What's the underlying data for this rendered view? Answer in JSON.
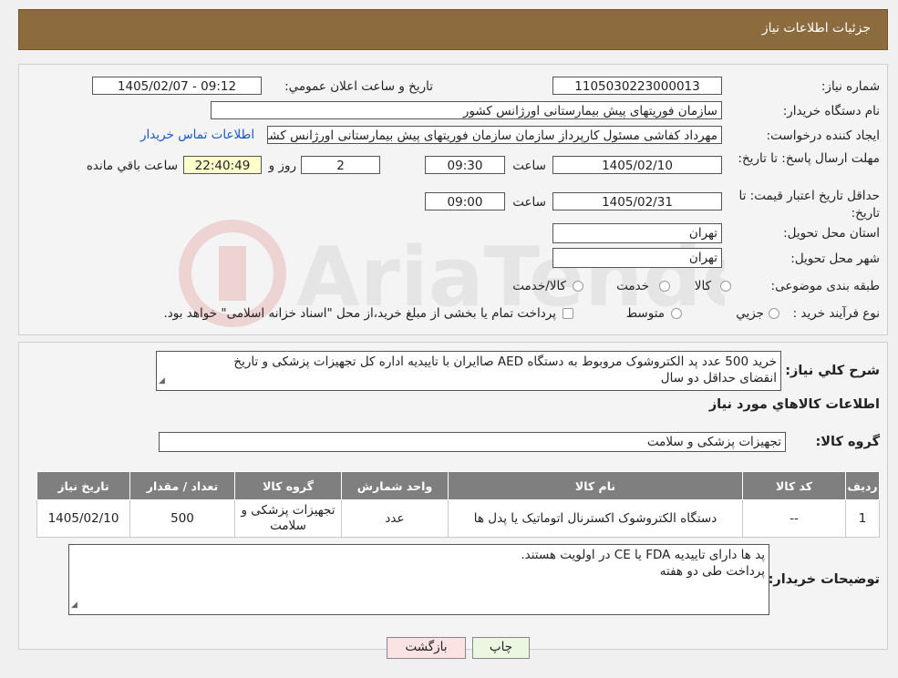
{
  "header": {
    "title": "جزئیات اطلاعات نیاز"
  },
  "form": {
    "need_number_label": "شماره نیاز:",
    "need_number": "1105030223000013",
    "announce_label": "تاریخ و ساعت اعلان عمومي:",
    "announce_value": "1405/02/07 - 09:12",
    "buyer_org_label": "نام دستگاه خريدار:",
    "buyer_org": "سازمان فوریتهای پیش بیمارستانی اورژانس کشور",
    "requester_label": "ايجاد کننده درخواست:",
    "requester": "مهرداد کفاشی مسئول کارپرداز سازمان سازمان فوریتهای پیش بیمارستانی اورژانس کشور",
    "contact_link": "اطلاعات تماس خريدار",
    "deadline_label": "مهلت ارسال پاسخ: تا تاریخ:",
    "deadline_date": "1405/02/10",
    "time_label": "ساعت",
    "deadline_time": "09:30",
    "days_value": "2",
    "days_label": "روز و",
    "remaining_time": "22:40:49",
    "remaining_label": "ساعت باقي مانده",
    "validity_label": "حداقل تاريخ اعتبار قيمت: تا تاریخ:",
    "validity_date": "1405/02/31",
    "validity_time": "09:00",
    "province_label": "استان محل تحويل:",
    "province": "تهران",
    "city_label": "شهر محل تحويل:",
    "city": "تهران",
    "category_label": "طبقه بندی موضوعی:",
    "category_options": [
      "کالا",
      "خدمت",
      "کالا/خدمت"
    ],
    "purchase_type_label": "نوع فرآيند خريد :",
    "purchase_type_options": [
      "جزيي",
      "متوسط"
    ],
    "purchase_note": "پرداخت تمام يا بخشی از مبلغ خريد،از محل \"اسناد خزانه اسلامی\" خواهد بود."
  },
  "description": {
    "label": "شرح کلي نياز:",
    "line1": "خرید 500 عدد پد الکتروشوک مروبوط به دستگاه AED صاایران با تاییدیه اداره کل تجهیزات پزشکی و تاریخ",
    "line2": "انقضای حداقل دو سال"
  },
  "goods": {
    "section_title": "اطلاعات کالاهاي مورد نياز",
    "group_label": "گروه کالا:",
    "group_value": "تجهیزات پزشکی و سلامت",
    "columns": [
      "رديف",
      "کد کالا",
      "نام کالا",
      "واحد شمارش",
      "گروه کالا",
      "تعداد / مقدار",
      "تاريخ نياز"
    ],
    "rows": [
      [
        "1",
        "--",
        "دستگاه الکتروشوک اکسترنال اتوماتیک یا پدل ها",
        "عدد",
        "تجهیزات پزشکی و سلامت",
        "500",
        "1405/02/10"
      ]
    ]
  },
  "buyer_notes": {
    "label": "توضيحات خريدار:",
    "line1": "پد ها دارای تاییدیه  FDA یا CE در اولویت هستند.",
    "line2": "پرداخت طی دو هفته"
  },
  "buttons": {
    "print": "چاپ",
    "back": "بازگشت"
  },
  "colors": {
    "header_bg": "#8c6b3e",
    "print_btn": "#ecf7e2",
    "back_btn": "#fbe3e3",
    "link": "#1a56c8"
  }
}
